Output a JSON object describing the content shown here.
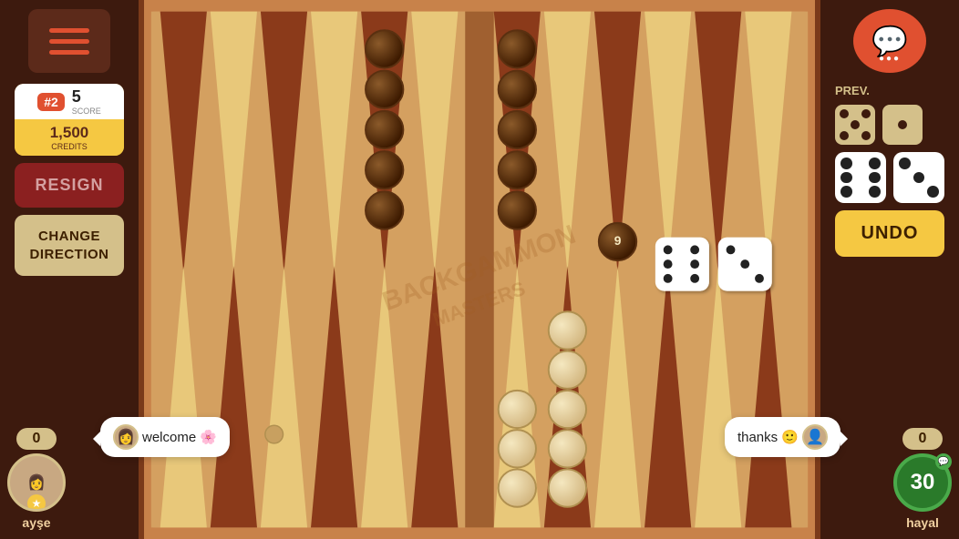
{
  "leftPanel": {
    "menuLabel": "☰",
    "rank": "#2",
    "scoreLabel": "SCORE",
    "scoreValue": "5",
    "creditsValue": "1,500",
    "creditsLabel": "CREDITS",
    "resignLabel": "RESIGN",
    "changeDirectionLabel": "CHANGE DIRECTION",
    "playerScore": "0",
    "playerName": "ayşe",
    "chatMessage": "welcome 🌸"
  },
  "rightPanel": {
    "prevLabel": "PREV.",
    "undoLabel": "UNDO",
    "playerScore": "0",
    "playerName": "hayal",
    "timerValue": "30",
    "chatMessage": "thanks 🙂"
  },
  "board": {
    "watermark": "BACKGAMMON",
    "die1": [
      6,
      5
    ],
    "die2": [
      3,
      1
    ],
    "prevDie1": [
      5,
      5
    ],
    "prevDie2": [
      1,
      1
    ],
    "checkerNumber": "9"
  }
}
